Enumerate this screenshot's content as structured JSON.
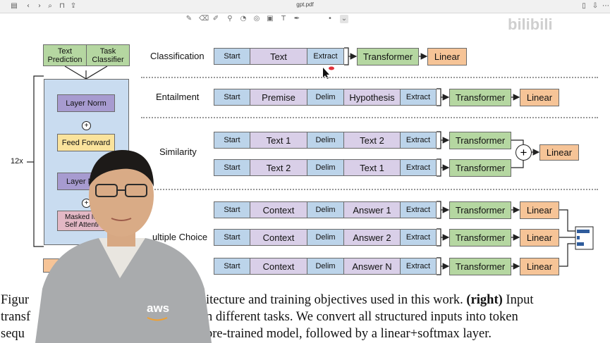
{
  "toolbar": {
    "file_title": "gpt.pdf"
  },
  "left_arch": {
    "top_boxes": [
      "Text Prediction",
      "Task Classifier"
    ],
    "layer_norm_top": "Layer Norm",
    "feed_forward": "Feed Forward",
    "layer_norm_mid": "Layer N",
    "masked_attention_line1": "Masked M",
    "masked_attention_line2": "Self Attenti",
    "repeat": "12x",
    "plus": "+"
  },
  "tasks": {
    "classification": {
      "label": "Classification",
      "tokens": [
        "Start",
        "Text",
        "Extract"
      ],
      "transformer": "Transformer",
      "linear": "Linear"
    },
    "entailment": {
      "label": "Entailment",
      "tokens": [
        "Start",
        "Premise",
        "Delim",
        "Hypothesis",
        "Extract"
      ],
      "transformer": "Transformer",
      "linear": "Linear"
    },
    "similarity": {
      "label": "Similarity",
      "row1": [
        "Start",
        "Text 1",
        "Delim",
        "Text 2",
        "Extract"
      ],
      "row2": [
        "Start",
        "Text 2",
        "Delim",
        "Text 1",
        "Extract"
      ],
      "transformer": "Transformer",
      "plus": "+",
      "linear": "Linear"
    },
    "multiple_choice": {
      "label": "ultiple Choice",
      "rows": [
        [
          "Start",
          "Context",
          "Delim",
          "Answer 1",
          "Extract"
        ],
        [
          "Start",
          "Context",
          "Delim",
          "Answer 2",
          "Extract"
        ],
        [
          "Start",
          "Context",
          "Delim",
          "Answer N",
          "Extract"
        ]
      ],
      "transformer": "Transformer",
      "linear": "Linear"
    }
  },
  "caption": {
    "line1_a": "Figur",
    "line1_b": "itecture and training objectives used in this work.",
    "line1_bold": "(right)",
    "line1_c": "Input",
    "line2_a": "transf",
    "line2_b": "n different tasks.  We convert all structured inputs into token",
    "line3_a": "sequ",
    "line3_b": "pre-trained model, followed by a linear+softmax layer."
  },
  "colors": {
    "start_token": "#bcd4ea",
    "text_token": "#d9cfe8",
    "transformer": "#b5d7a1",
    "linear": "#f6c497",
    "arch_panel": "#c9dcf0",
    "arch_norm": "#a79bd0",
    "arch_ff": "#fae39c",
    "arch_attention": "#e3b8c5"
  },
  "watermark": "bilibili"
}
